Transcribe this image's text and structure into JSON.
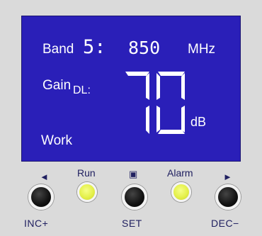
{
  "display": {
    "band_label": "Band",
    "band_number": "5:",
    "frequency": "850",
    "frequency_unit": "MHz",
    "gain_label": "Gain",
    "gain_subscript": "DL:",
    "gain_value": "70",
    "gain_unit": "dB",
    "status": "Work"
  },
  "controls": {
    "left_arrow": "◄",
    "run_label": "Run",
    "set_symbol": "▣",
    "alarm_label": "Alarm",
    "right_arrow": "►",
    "inc_label": "INC+",
    "set_label": "SET",
    "dec_label": "DEC−"
  },
  "colors": {
    "lcd_background": "#2a1fb8",
    "lcd_text": "#ffffff",
    "led_color": "#e4f04a",
    "label_color": "#202060"
  }
}
